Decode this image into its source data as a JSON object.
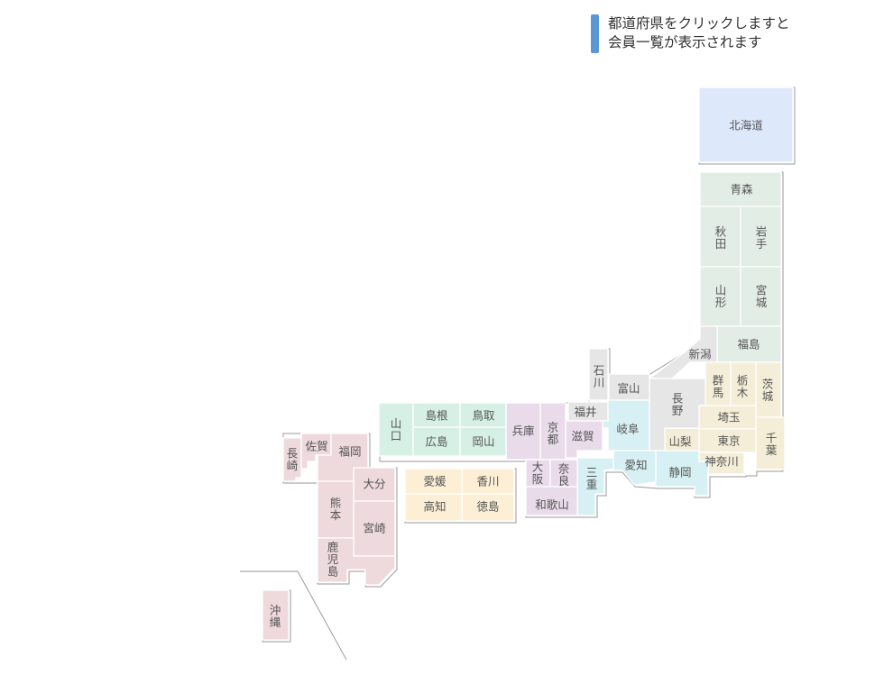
{
  "notice": {
    "line1": "都道府県をクリックしますと",
    "line2": "会員一覧が表示されます"
  },
  "colors": {
    "hokkaido": "#dde8fb",
    "tohoku": "#e2ede5",
    "kanto": "#f4eed8",
    "chubu_gray": "#e6e6e6",
    "tokai": "#d7f0f3",
    "kinki": "#eadbea",
    "chugoku": "#d6f0e5",
    "shikoku": "#fcefd6",
    "kyushu": "#eed9dc"
  },
  "prefectures": [
    {
      "id": "hokkaido",
      "label": "北海道",
      "region": "hokkaido"
    },
    {
      "id": "aomori",
      "label": "青森",
      "region": "tohoku"
    },
    {
      "id": "akita",
      "label": "秋田",
      "region": "tohoku"
    },
    {
      "id": "iwate",
      "label": "岩手",
      "region": "tohoku"
    },
    {
      "id": "yamagata",
      "label": "山形",
      "region": "tohoku"
    },
    {
      "id": "miyagi",
      "label": "宮城",
      "region": "tohoku"
    },
    {
      "id": "fukushima",
      "label": "福島",
      "region": "tohoku"
    },
    {
      "id": "niigata",
      "label": "新潟",
      "region": "chubu_gray"
    },
    {
      "id": "gunma",
      "label": "群馬",
      "region": "kanto"
    },
    {
      "id": "tochigi",
      "label": "栃木",
      "region": "kanto"
    },
    {
      "id": "ibaraki",
      "label": "茨城",
      "region": "kanto"
    },
    {
      "id": "saitama",
      "label": "埼玉",
      "region": "kanto"
    },
    {
      "id": "tokyo",
      "label": "東京",
      "region": "kanto"
    },
    {
      "id": "chiba",
      "label": "千葉",
      "region": "kanto"
    },
    {
      "id": "kanagawa",
      "label": "神奈川",
      "region": "kanto"
    },
    {
      "id": "yamanashi",
      "label": "山梨",
      "region": "kanto"
    },
    {
      "id": "nagano",
      "label": "長野",
      "region": "chubu_gray"
    },
    {
      "id": "toyama",
      "label": "富山",
      "region": "chubu_gray"
    },
    {
      "id": "ishikawa",
      "label": "石川",
      "region": "chubu_gray"
    },
    {
      "id": "fukui",
      "label": "福井",
      "region": "chubu_gray"
    },
    {
      "id": "gifu",
      "label": "岐阜",
      "region": "tokai"
    },
    {
      "id": "shizuoka",
      "label": "静岡",
      "region": "tokai"
    },
    {
      "id": "aichi",
      "label": "愛知",
      "region": "tokai"
    },
    {
      "id": "mie",
      "label": "三重",
      "region": "tokai"
    },
    {
      "id": "shiga",
      "label": "滋賀",
      "region": "kinki"
    },
    {
      "id": "kyoto",
      "label": "京都",
      "region": "kinki"
    },
    {
      "id": "hyogo",
      "label": "兵庫",
      "region": "kinki"
    },
    {
      "id": "osaka",
      "label": "大阪",
      "region": "kinki"
    },
    {
      "id": "nara",
      "label": "奈良",
      "region": "kinki"
    },
    {
      "id": "wakayama",
      "label": "和歌山",
      "region": "kinki"
    },
    {
      "id": "yamaguchi",
      "label": "山口",
      "region": "chugoku"
    },
    {
      "id": "shimane",
      "label": "島根",
      "region": "chugoku"
    },
    {
      "id": "tottori",
      "label": "鳥取",
      "region": "chugoku"
    },
    {
      "id": "hiroshima",
      "label": "広島",
      "region": "chugoku"
    },
    {
      "id": "okayama",
      "label": "岡山",
      "region": "chugoku"
    },
    {
      "id": "ehime",
      "label": "愛媛",
      "region": "shikoku"
    },
    {
      "id": "kagawa",
      "label": "香川",
      "region": "shikoku"
    },
    {
      "id": "kochi",
      "label": "高知",
      "region": "shikoku"
    },
    {
      "id": "tokushima",
      "label": "徳島",
      "region": "shikoku"
    },
    {
      "id": "nagasaki",
      "label": "長崎",
      "region": "kyushu"
    },
    {
      "id": "saga",
      "label": "佐賀",
      "region": "kyushu"
    },
    {
      "id": "fukuoka",
      "label": "福岡",
      "region": "kyushu"
    },
    {
      "id": "oita",
      "label": "大分",
      "region": "kyushu"
    },
    {
      "id": "kumamoto",
      "label": "熊本",
      "region": "kyushu"
    },
    {
      "id": "miyazaki",
      "label": "宮崎",
      "region": "kyushu"
    },
    {
      "id": "kagoshima",
      "label": "鹿児島",
      "region": "kyushu"
    },
    {
      "id": "okinawa",
      "label": "沖縄",
      "region": "kyushu"
    }
  ]
}
